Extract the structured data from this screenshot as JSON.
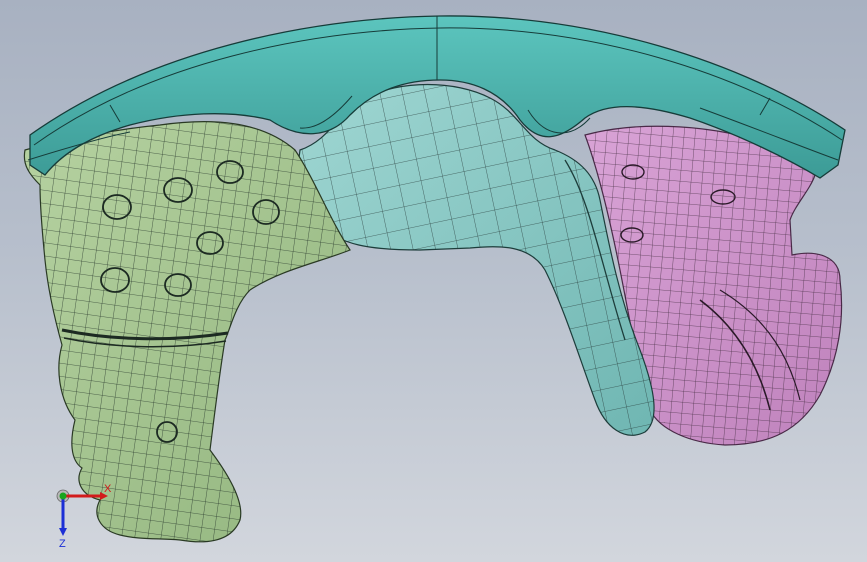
{
  "viewport": {
    "background_top": "#a8b1c1",
    "background_bottom": "#d2d6dd"
  },
  "model": {
    "parts": [
      {
        "name": "arch-band",
        "color": "#4fb4ad"
      },
      {
        "name": "left-part",
        "color": "#a9c795"
      },
      {
        "name": "center-part",
        "color": "#8ccac6"
      },
      {
        "name": "right-part",
        "color": "#cf94cc"
      }
    ],
    "mesh_color": "#1c2a22"
  },
  "triad": {
    "x_label": "X",
    "y_label": "Y",
    "z_label": "Z",
    "x_color": "#d21b1b",
    "y_color": "#19a51e",
    "z_color": "#1c2fd6"
  }
}
